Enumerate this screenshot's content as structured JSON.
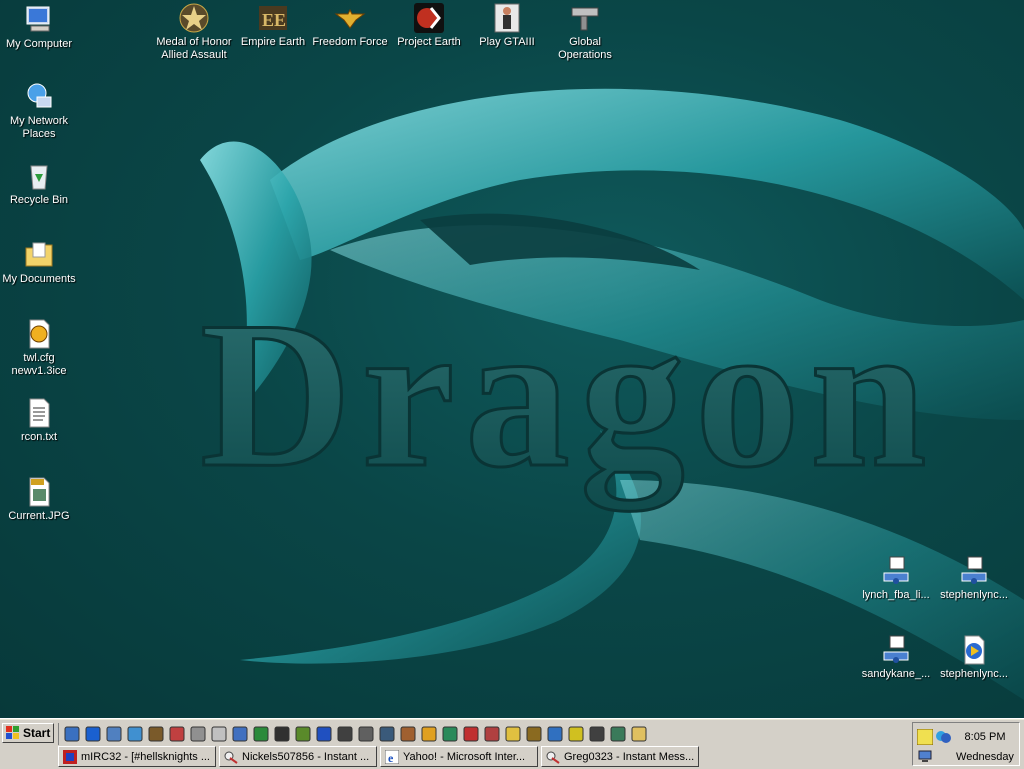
{
  "desktop": {
    "left_icons": [
      {
        "label": "My Computer",
        "icon": "computer-icon"
      },
      {
        "label": "My Network Places",
        "icon": "network-icon"
      },
      {
        "label": "Recycle Bin",
        "icon": "recycle-bin-icon"
      },
      {
        "label": "My Documents",
        "icon": "folder-icon"
      },
      {
        "label": "twl.cfg newv1.3ice",
        "icon": "config-file-icon"
      },
      {
        "label": "rcon.txt",
        "icon": "text-file-icon"
      },
      {
        "label": "Current.JPG",
        "icon": "jpg-file-icon"
      }
    ],
    "top_icons": [
      {
        "label": "Medal of Honor Allied Assault",
        "icon": "medal-icon"
      },
      {
        "label": "Empire Earth",
        "icon": "empire-earth-icon"
      },
      {
        "label": "Freedom Force",
        "icon": "freedom-force-icon"
      },
      {
        "label": "Project Earth",
        "icon": "project-earth-icon"
      },
      {
        "label": "Play GTAIII",
        "icon": "gta-icon"
      },
      {
        "label": "Global Operations",
        "icon": "gun-icon"
      }
    ],
    "right_icons": [
      {
        "label": "lynch_fba_li...",
        "icon": "network-file-icon"
      },
      {
        "label": "stephenlync...",
        "icon": "network-file-icon"
      },
      {
        "label": "sandykane_...",
        "icon": "network-file-icon"
      },
      {
        "label": "stephenlync...",
        "icon": "media-file-icon"
      }
    ],
    "wallpaper_text": "Dragon"
  },
  "taskbar": {
    "start_label": "Start",
    "quick_launch": [
      "desktop-icon",
      "ie-icon",
      "outlook-icon",
      "media-icon",
      "app-icon",
      "settings-icon",
      "app-icon",
      "app-icon",
      "search-icon",
      "play-icon",
      "app-icon",
      "app-icon",
      "app-icon",
      "app-icon",
      "app-icon",
      "app-icon",
      "app-icon",
      "app-icon",
      "app-icon",
      "app-icon",
      "app-icon",
      "app-icon",
      "app-icon",
      "app-icon",
      "app-icon",
      "app-icon",
      "app-icon",
      "folder-icon"
    ],
    "tasks": [
      {
        "label": "mIRC32 - [#hellsknights ...",
        "icon": "mirc-icon"
      },
      {
        "label": "Nickels507856 - Instant ...",
        "icon": "im-icon"
      },
      {
        "label": "Yahoo! - Microsoft Inter...",
        "icon": "ie-icon"
      },
      {
        "label": "Greg0323 - Instant Mess...",
        "icon": "im-icon"
      }
    ],
    "clock": "8:05 PM",
    "day": "Wednesday"
  },
  "colors": {
    "desktop": "#0a4647",
    "taskbar": "#d4d0c8"
  }
}
